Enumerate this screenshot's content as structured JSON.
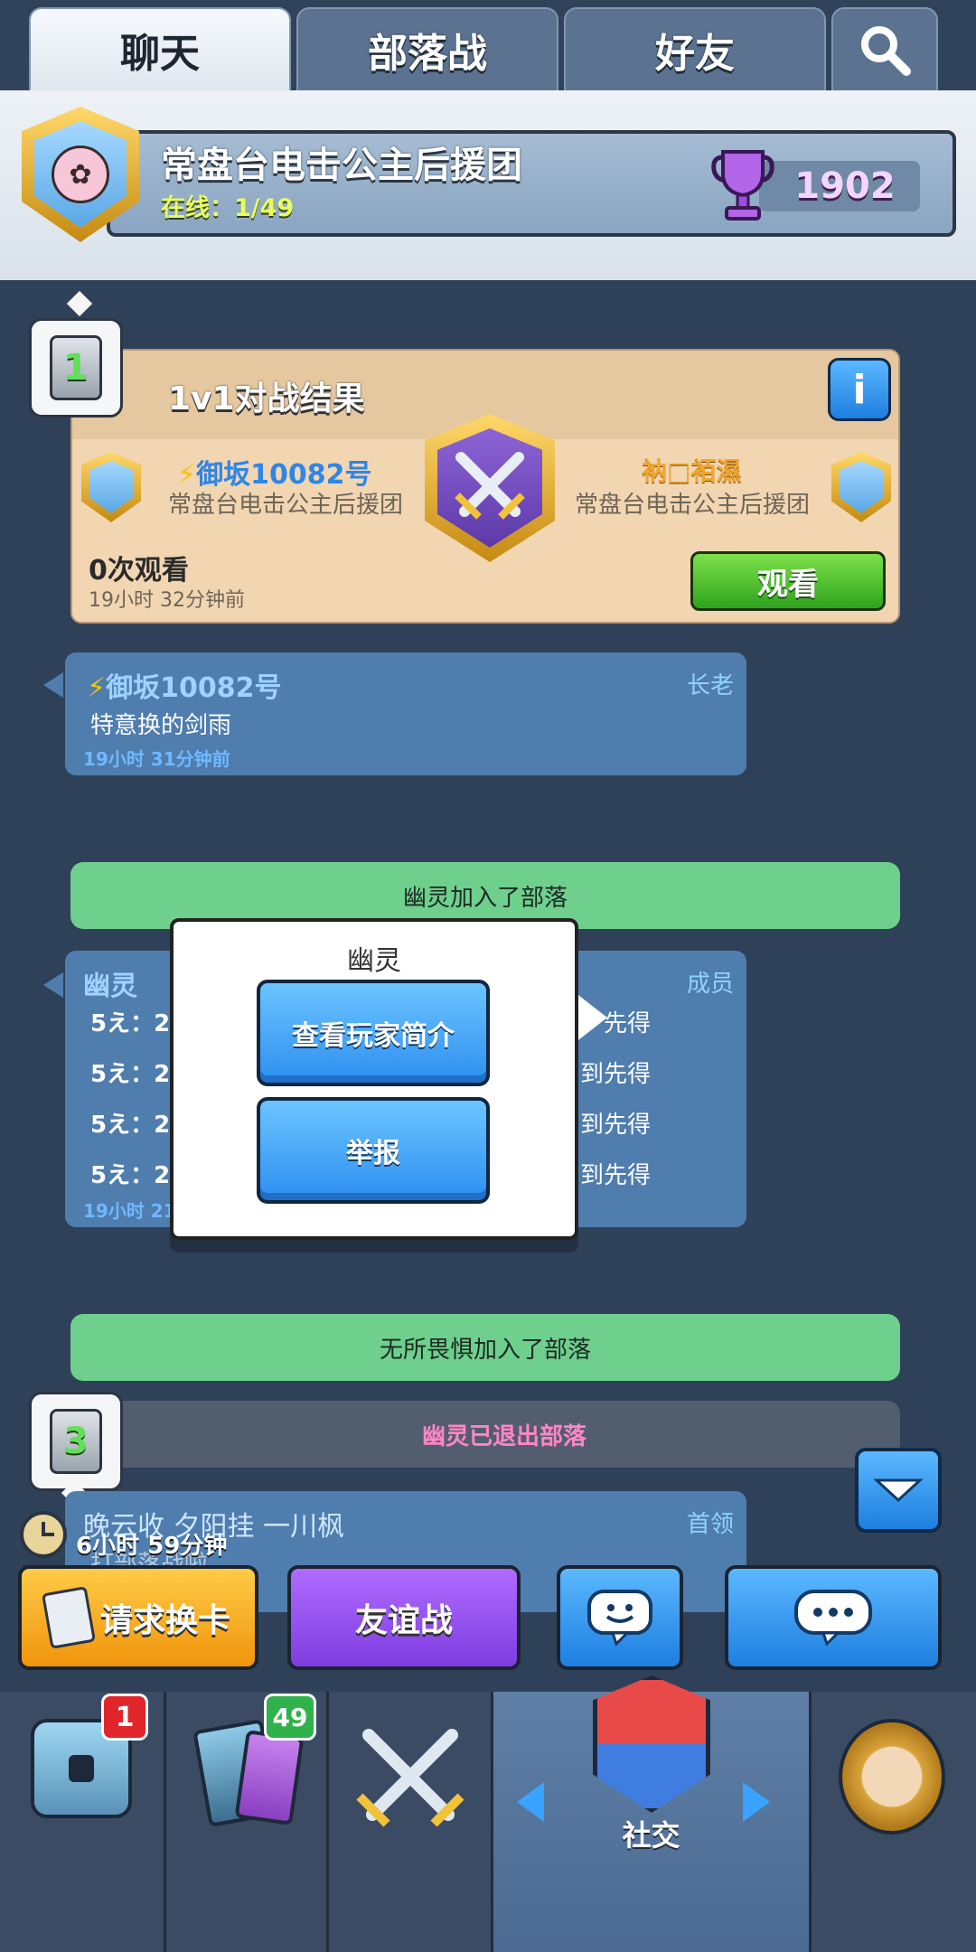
{
  "tabs": [
    "聊天",
    "部落战",
    "好友"
  ],
  "clan": {
    "name": "常盘台电击公主后援团",
    "online": "在线：1/49",
    "trophies": "1902"
  },
  "badge1": "1",
  "battle": {
    "title": "1v1对战结果",
    "info": "i",
    "player1": {
      "bolt": "⚡",
      "name": "御坂10082号",
      "clan": "常盘台电击公主后援团"
    },
    "player2": {
      "name": "衲□袹濕",
      "clan": "常盘台电击公主后援团"
    },
    "views": "0次观看",
    "time": "19小时 32分钟前",
    "watch": "观看"
  },
  "msg1": {
    "bolt": "⚡",
    "name": "御坂10082号",
    "role": "长老",
    "text": "特意换的剑雨",
    "time": "19小时 31分钟前"
  },
  "event1": "幽灵加入了部落",
  "msg2": {
    "name": "幽灵",
    "role": "成员",
    "lines": [
      "5え：2",
      "5え：2",
      "5え：2",
      "5え：2"
    ],
    "tails": [
      "先得",
      "到先得",
      "到先得",
      "到先得"
    ],
    "time": "19小时 21"
  },
  "popup": {
    "title": "幽灵",
    "profile": "查看玩家简介",
    "report": "举报"
  },
  "event2": "无所畏惧加入了部落",
  "event3": "幽灵已退出部落",
  "badge3": "3",
  "msg3": {
    "name": "晚云收 夕阳挂 一川枫",
    "role": "首领",
    "text": "打部落战啦"
  },
  "timer": "6小时 59分钟",
  "actions": {
    "request": "请求换卡",
    "friendly": "友谊战"
  },
  "nav": {
    "chest_badge": "1",
    "cards_badge": "49",
    "social": "社交"
  }
}
